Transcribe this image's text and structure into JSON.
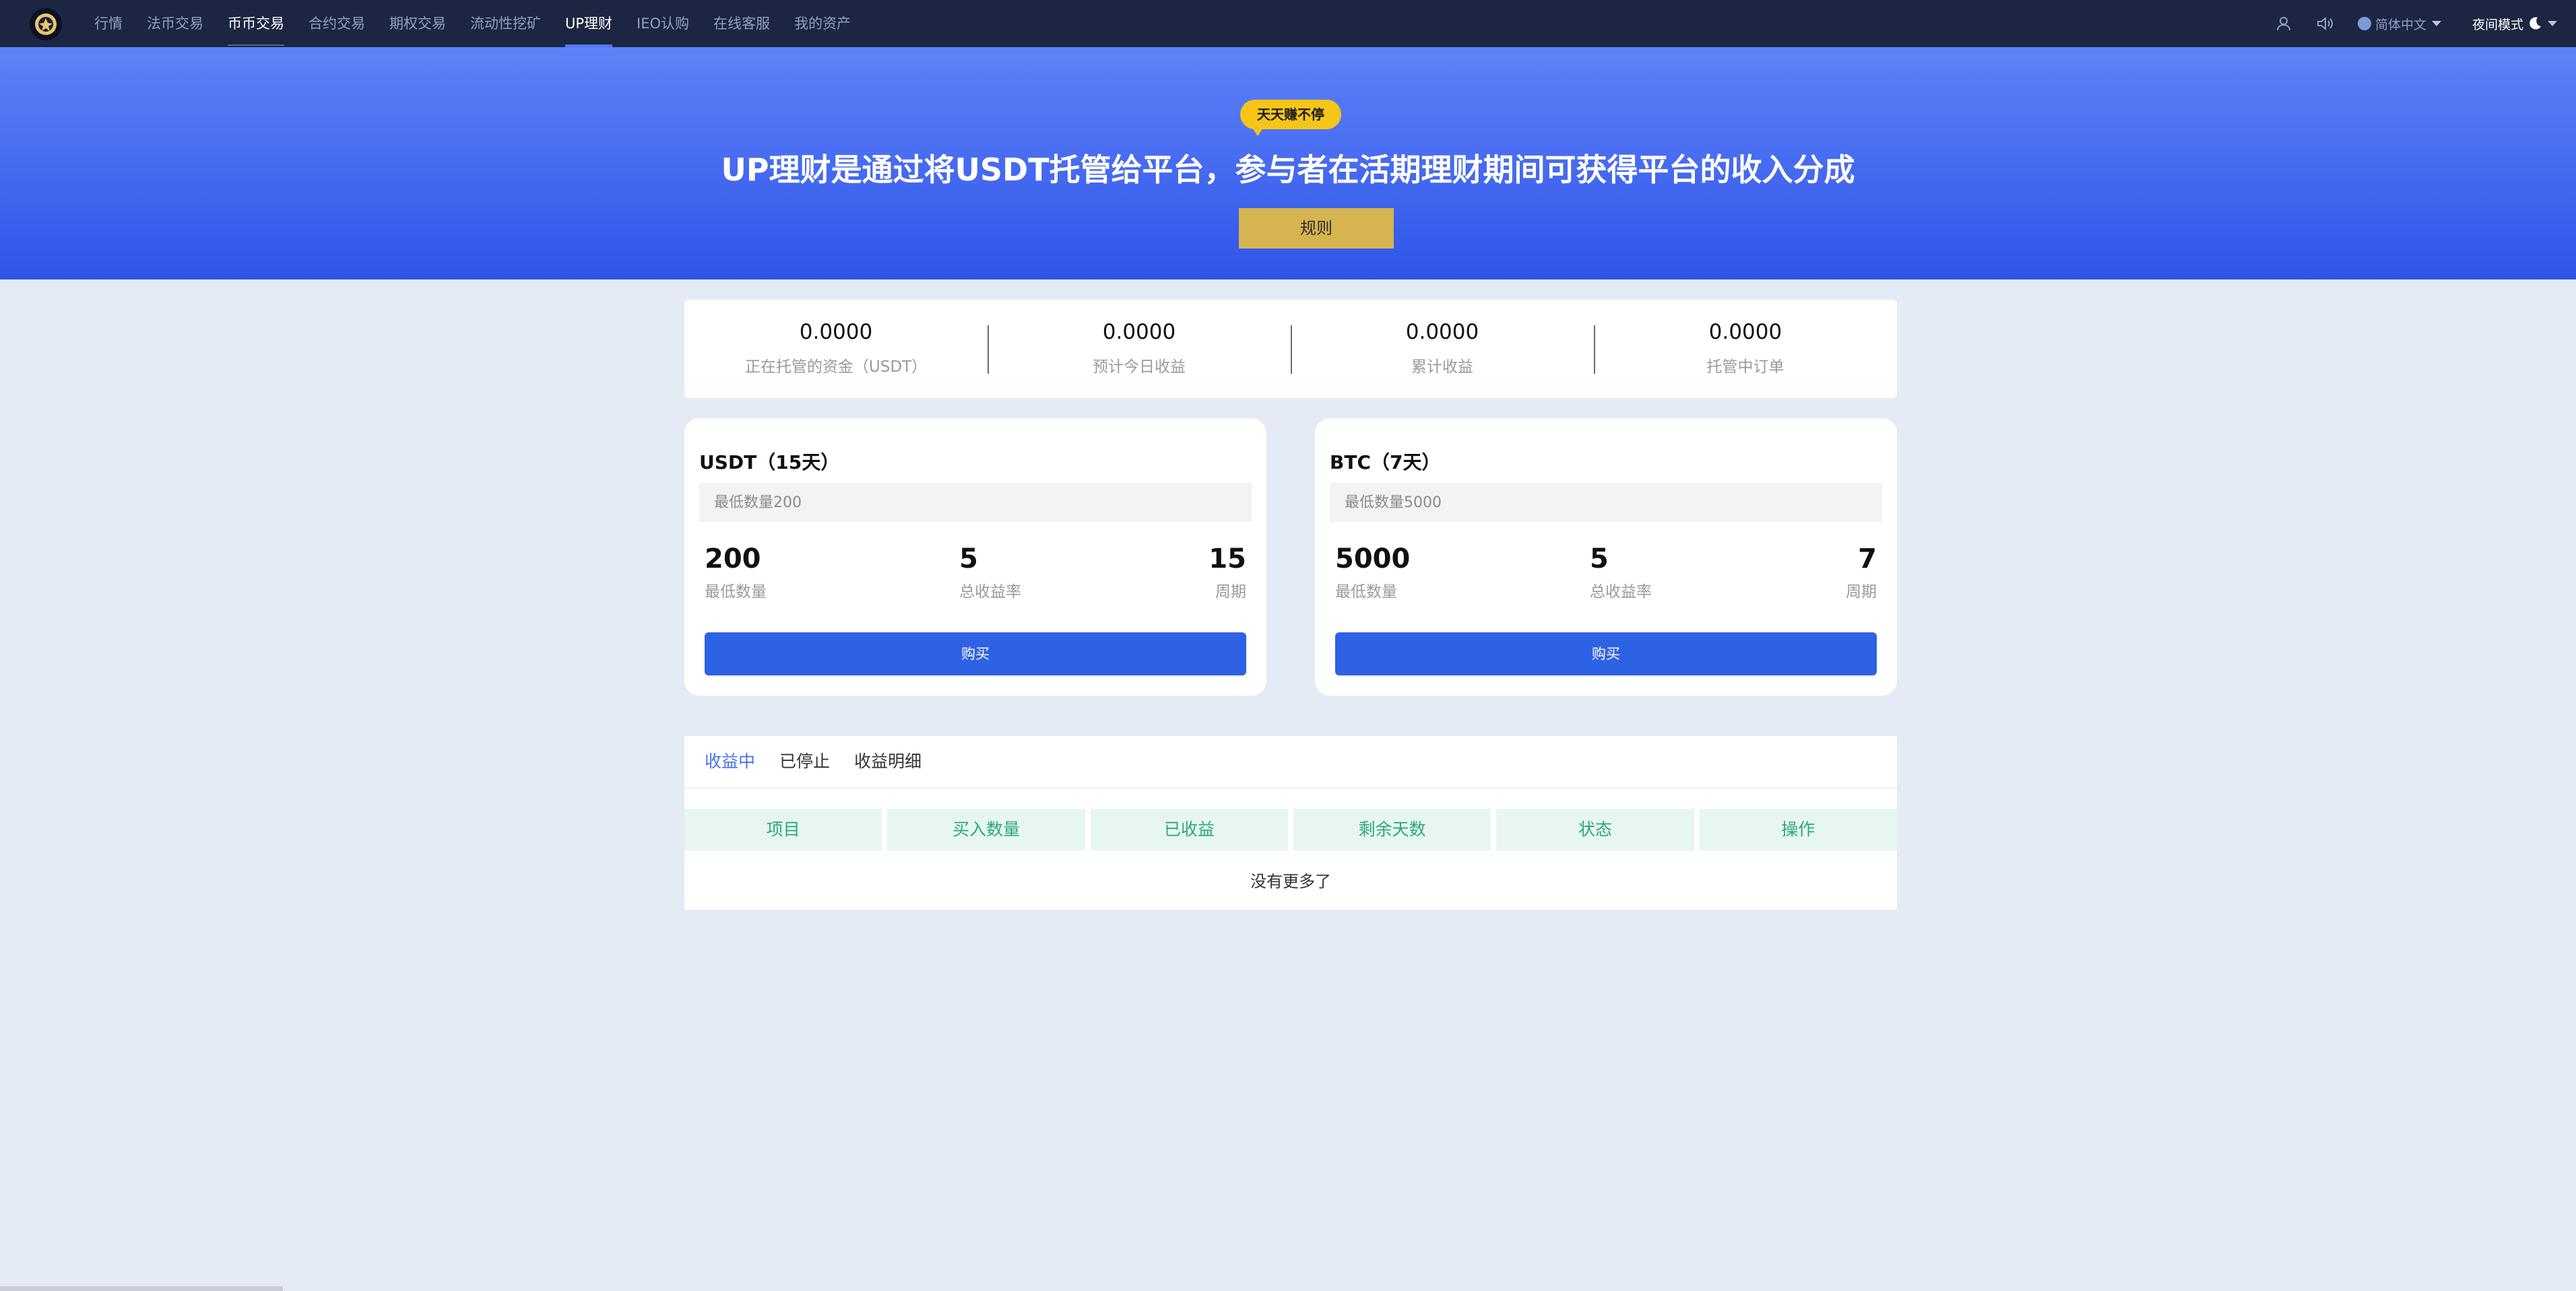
{
  "nav": {
    "items": [
      "行情",
      "法币交易",
      "币币交易",
      "合约交易",
      "期权交易",
      "流动性挖矿",
      "UP理财",
      "IEO认购",
      "在线客服",
      "我的资产"
    ],
    "language": "简体中文",
    "night_mode": "夜间模式",
    "icons": [
      "user-icon",
      "speaker-icon",
      "globe-icon",
      "moon-icon"
    ]
  },
  "banner": {
    "badge": "天天赚不停",
    "title": "UP理财是通过将USDT托管给平台，参与者在活期理财期间可获得平台的收入分成",
    "rules_button": "规则"
  },
  "stats": [
    {
      "value": "0.0000",
      "label": "正在托管的资金（USDT）"
    },
    {
      "value": "0.0000",
      "label": "预计今日收益"
    },
    {
      "value": "0.0000",
      "label": "累计收益"
    },
    {
      "value": "0.0000",
      "label": "托管中订单"
    }
  ],
  "products": [
    {
      "title": "USDT（15天）",
      "placeholder": "最低数量200",
      "min_amount": "200",
      "min_amount_label": "最低数量",
      "rate": "5",
      "rate_label": "总收益率",
      "period": "15",
      "period_label": "周期",
      "buy_label": "购买"
    },
    {
      "title": "BTC（7天）",
      "placeholder": "最低数量5000",
      "min_amount": "5000",
      "min_amount_label": "最低数量",
      "rate": "5",
      "rate_label": "总收益率",
      "period": "7",
      "period_label": "周期",
      "buy_label": "购买"
    }
  ],
  "orders": {
    "tabs": [
      "收益中",
      "已停止",
      "收益明细"
    ],
    "columns": [
      "项目",
      "买入数量",
      "已收益",
      "剩余天数",
      "状态",
      "操作"
    ],
    "empty_text": "没有更多了"
  },
  "colors": {
    "nav_bg": "#1c2542",
    "banner_top": "#5f82f8",
    "banner_bottom": "#2f55e9",
    "badge": "#f5c518",
    "rules_button": "#d6b44f",
    "buy_button": "#2e62e4",
    "table_header_bg": "#e8f6f0",
    "table_header_text": "#2aa878",
    "page_bg": "#e4ebf4"
  }
}
